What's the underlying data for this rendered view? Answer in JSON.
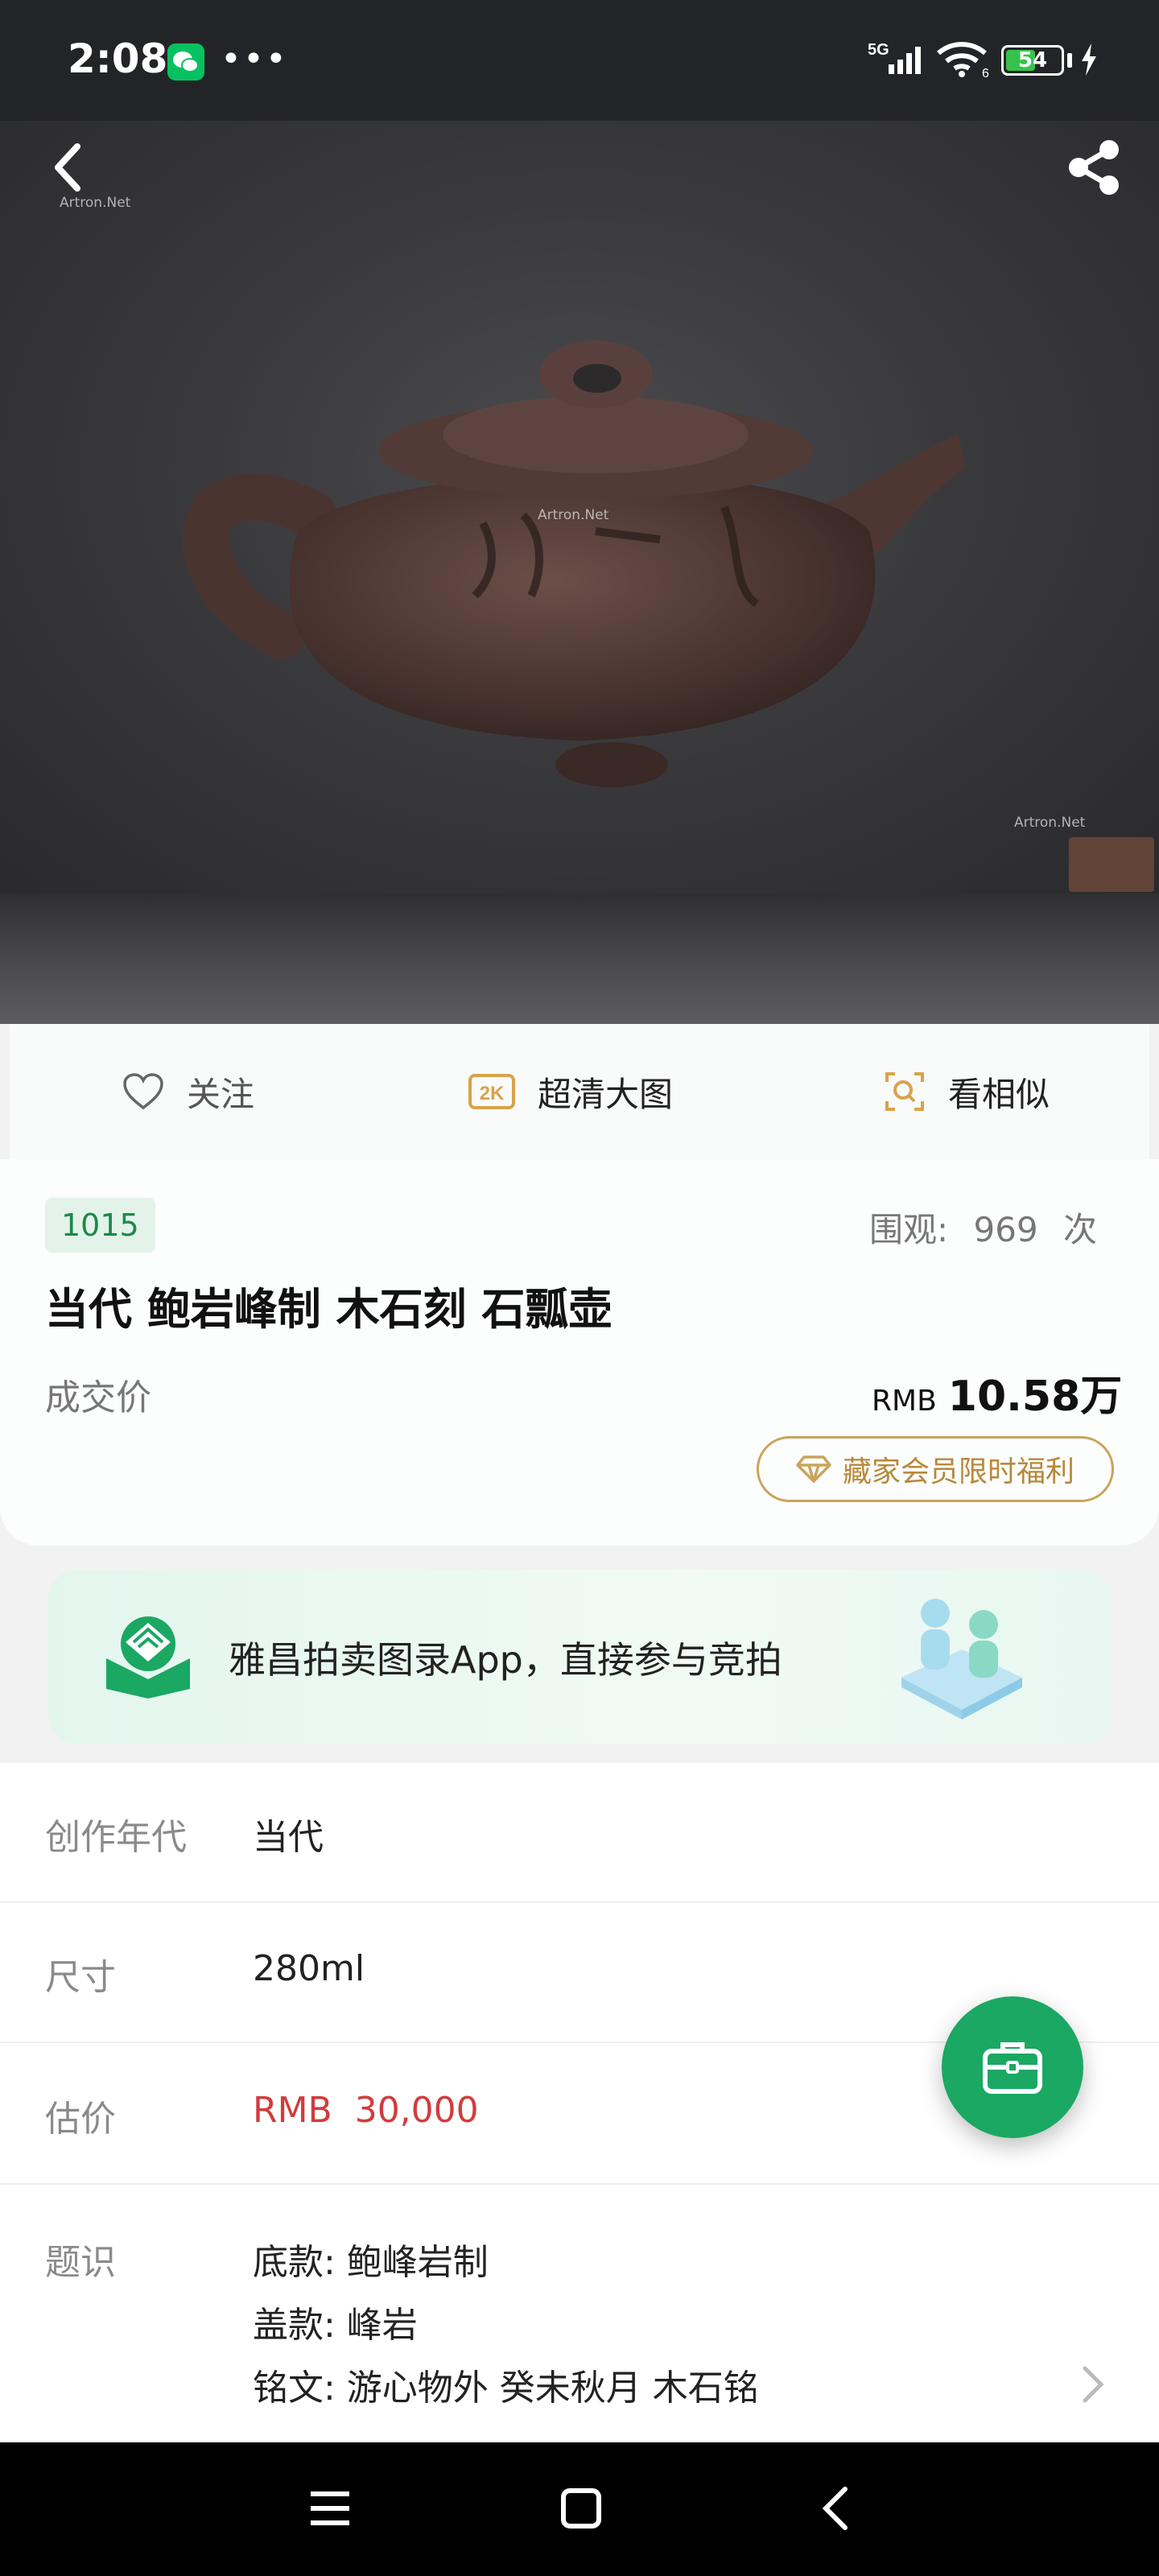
{
  "status_bar": {
    "time": "2:08",
    "dots": "•••",
    "network": "5G",
    "wifi_level": "6",
    "battery": "54",
    "battery_fraction": 0.54
  },
  "hero": {
    "watermark": "Artron.Net"
  },
  "actions": {
    "follow": "关注",
    "hd_badge": "2K",
    "hd": "超清大图",
    "similar": "看相似"
  },
  "info": {
    "lot_number": "1015",
    "views_label": "围观:",
    "views_count": "969",
    "views_unit": "次",
    "title": "当代 鲍岩峰制 木石刻 石瓢壶",
    "deal_label": "成交价",
    "price_currency": "RMB",
    "price_value": "10.58万",
    "member_button": "藏家会员限时福利"
  },
  "banner": {
    "text": "雅昌拍卖图录App，直接参与竞拍"
  },
  "details": {
    "year_label": "创作年代",
    "year_value": "当代",
    "size_label": "尺寸",
    "size_value": "280ml",
    "estimate_label": "估价",
    "estimate_value": "RMB  30,000",
    "marks_label": "题识",
    "marks": [
      "底款: 鲍峰岩制",
      "盖款: 峰岩",
      "铭文: 游心物外 癸未秋月 木石铭"
    ]
  },
  "colors": {
    "accent_green": "#1aa863",
    "estimate_red": "#d23c3c",
    "gold": "#c9a45c"
  }
}
